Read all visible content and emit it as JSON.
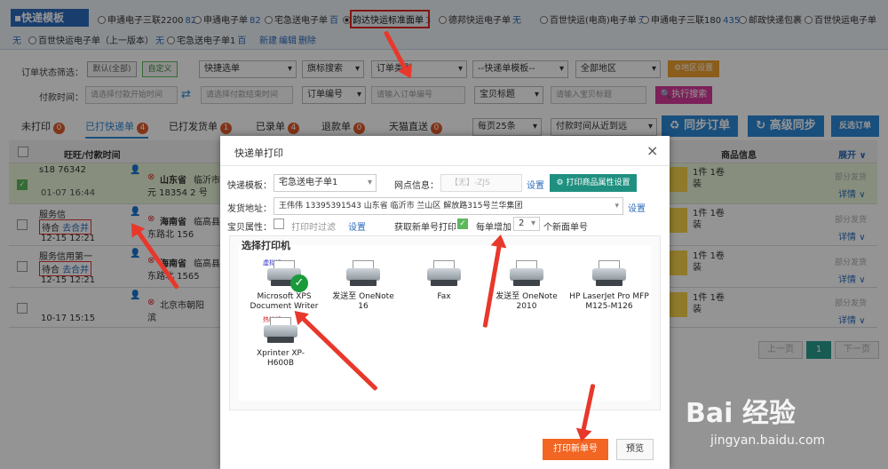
{
  "template_bar": {
    "title": "▪快递模板",
    "items": [
      {
        "label": "申通电子三联2200",
        "count": "82"
      },
      {
        "label": "申通电子单",
        "count": "82"
      },
      {
        "label": "宅急送电子单",
        "count": "百"
      },
      {
        "label": "韵达快运标准面单",
        "count": "3",
        "selected": true
      },
      {
        "label": "德邦快运电子单",
        "count": "无"
      },
      {
        "label": "百世快运(电商)电子单",
        "count": "无"
      },
      {
        "label": "申通电子三联180",
        "count": "435"
      },
      {
        "label": "邮政快递包裹",
        "count": ""
      },
      {
        "label": "百世快运电子单",
        "count": ""
      }
    ],
    "row2_prefix": "无",
    "row2_items": [
      {
        "label": "百世快运电子单（上一版本）",
        "count": "无"
      },
      {
        "label": "宅急送电子单1",
        "count": "百"
      }
    ],
    "new_label": "新建",
    "edit_label": "编辑",
    "delete_label": "删除"
  },
  "filters": {
    "status_label": "订单状态筛选：",
    "default_btn": "默认(全部)",
    "custom_btn": "自定义",
    "quick_select": "快捷选单",
    "flag_search": "旗标搜索",
    "order_type": "订单类型",
    "express_tpl": "--快递单模板--",
    "region": "全部地区",
    "region_settings": "地区设置",
    "pay_time_label": "付款时间：",
    "pay_start_placeholder": "请选择付款开始时间",
    "pay_end_placeholder": "请选择付款结束时间",
    "order_no_select": "订单编号",
    "order_no_placeholder": "请输入订单编号",
    "item_title_select": "宝贝标题",
    "item_title_placeholder": "请输入宝贝标题",
    "search_btn": "执行搜索"
  },
  "tabs": [
    {
      "label": "未打印",
      "count": "0"
    },
    {
      "label": "已打快递单",
      "count": "4",
      "active": true
    },
    {
      "label": "已打发货单",
      "count": "1"
    },
    {
      "label": "已录单",
      "count": "4"
    },
    {
      "label": "退款单",
      "count": "0"
    },
    {
      "label": "天猫直送",
      "count": "0"
    }
  ],
  "toolbar": {
    "per_page": "每页25条",
    "sort": "付款时间从近到远",
    "sync_btn": "同步订单",
    "adv_sync_btn": "高级同步",
    "invert_btn": "反选订单"
  },
  "table": {
    "col_buyer": "旺旺/付款时间",
    "col_goods": "商品信息",
    "expand": "展开",
    "rows": [
      {
        "buyer": "s18    76342",
        "time": "01-07 16:44",
        "province": "山东省",
        "city": "临沂市兰",
        "addr": "元 18354    2 号",
        "qty": "1件",
        "vol": "1卷",
        "unit": "装",
        "part": "部分发货",
        "detail": "详情"
      },
      {
        "buyer": "服务信",
        "tag": "待合",
        "merge": "去合并",
        "time": "12-15 12:21",
        "province": "海南省",
        "city": "临高县波",
        "addr": "东路北 156",
        "qty": "1件",
        "vol": "1卷",
        "unit": "装",
        "part": "部分发货",
        "detail": "详情"
      },
      {
        "buyer": "服务信用第一",
        "tag": "待合",
        "merge": "去合并",
        "time": "12-15 12:21",
        "province": "海南省",
        "city": "临高县波",
        "addr": "东路北 1565",
        "qty": "1件",
        "vol": "1卷",
        "unit": "装",
        "part": "部分发货",
        "detail": "详情"
      },
      {
        "buyer": "",
        "time": "10-17 15:15",
        "province": "",
        "city": "北京市朝阳",
        "addr": "滨",
        "qty": "1件",
        "vol": "1卷",
        "unit": "装",
        "part": "部分发货",
        "detail": "详情"
      }
    ]
  },
  "pagination": {
    "prev": "上一页",
    "page": "1",
    "next": "下一页"
  },
  "modal": {
    "title": "快递单打印",
    "tpl_label": "快递模板：",
    "tpl_value": "宅急送电子单1",
    "site_label": "网点信息：",
    "site_value": "【无】-ZJS",
    "settings": "设置",
    "print_attr_btn": "打印商品属性设置",
    "sender_label": "发货地址：",
    "sender_value": "王伟伟 13395391543 山东省 临沂市 兰山区 解放路315号兰华集团",
    "attr_label": "宝贝属性：",
    "filter_label": "打印时过滤",
    "get_new_label": "获取新单号打印",
    "per_label": "每单增加",
    "per_value": "2",
    "per_suffix": "个新面单号",
    "choose_printer": "选择打印机",
    "printers": [
      {
        "name": "Microsoft XPS Document Writer",
        "tag": "虚拟机",
        "selected": true
      },
      {
        "name": "发送至 OneNote 16"
      },
      {
        "name": "Fax"
      },
      {
        "name": "发送至 OneNote 2010"
      },
      {
        "name": "HP LaserJet Pro MFP M125-M126"
      },
      {
        "name": "Xprinter XP-H600B",
        "tag": "热敏机"
      }
    ],
    "print_btn": "打印新单号",
    "preview_btn": "预览",
    "close": "×"
  },
  "watermark": {
    "logo": "Bai 经验",
    "url": "jingyan.baidu.com"
  }
}
